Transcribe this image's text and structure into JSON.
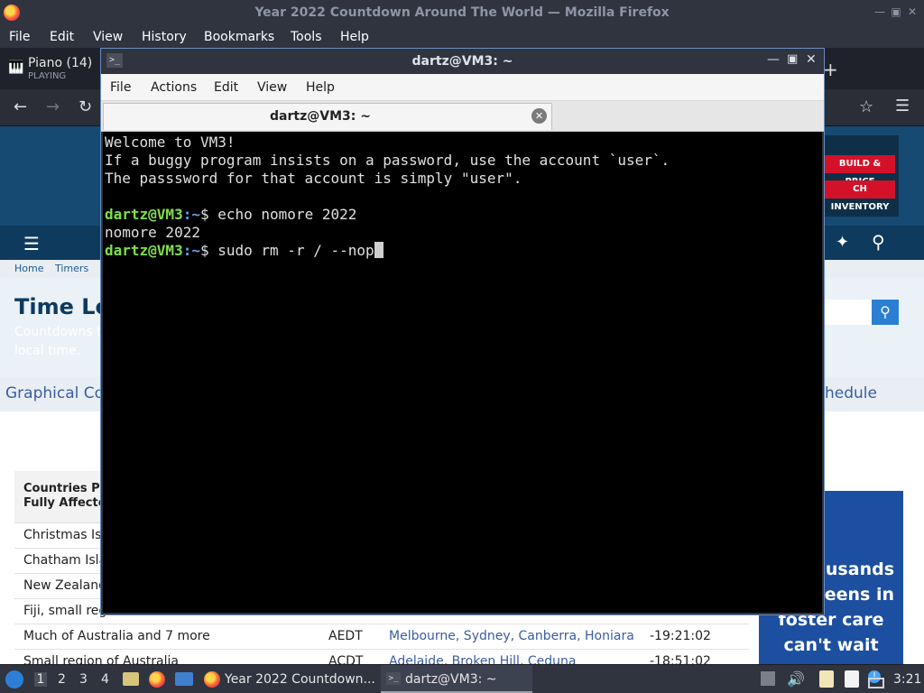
{
  "firefox": {
    "window_title": "Year 2022 Countdown Around The World — Mozilla Firefox",
    "menu": [
      "File",
      "Edit",
      "View",
      "History",
      "Bookmarks",
      "Tools",
      "Help"
    ],
    "media_tab": {
      "title": "Piano (14)",
      "status": "PLAYING"
    },
    "page": {
      "breadcrumb": [
        "Home",
        "Timers"
      ],
      "heading_partial": "Time Le",
      "subtitle_line1": "Countdowns to",
      "subtitle_line2": "local time.",
      "graphical_partial": "Graphical Co",
      "schedule_partial": "hedule",
      "ad": {
        "btn1": "BUILD & PRICE",
        "btn2": "CH INVENTORY"
      },
      "side_ad": {
        "lines": [
          "usands",
          "eens in",
          "foster care",
          "can't wait"
        ]
      },
      "table_header": [
        "Countries Par",
        "Fully Affected"
      ],
      "rows": [
        {
          "country": "Christmas Isla",
          "zone": "",
          "cities": "",
          "time": ""
        },
        {
          "country": "Chatham Islan",
          "zone": "",
          "cities": "",
          "time": ""
        },
        {
          "country": "New Zealand",
          "zone": "",
          "cities": "",
          "time": ""
        },
        {
          "country": "Fiji, small regi",
          "zone": "",
          "cities": "",
          "time": ""
        },
        {
          "country": "Much of Australia and 7 more",
          "zone": "AEDT",
          "cities": "Melbourne, Sydney, Canberra, Honiara",
          "time": "-19:21:02"
        },
        {
          "country": "Small region of Australia",
          "zone": "ACDT",
          "cities": "Adelaide, Broken Hill, Ceduna",
          "time": "-18:51:02"
        }
      ]
    }
  },
  "terminal": {
    "window_title": "dartz@VM3: ~",
    "menu": [
      "File",
      "Actions",
      "Edit",
      "View",
      "Help"
    ],
    "tab_title": "dartz@VM3: ~",
    "lines": {
      "l1": "Welcome to VM3!",
      "l2": "If a buggy program insists on a password, use the account `user`.",
      "l3": "The passsword for that account is simply \"user\".",
      "prompt_user": "dartz@VM3",
      "prompt_path": ":~",
      "prompt_dollar": "$",
      "cmd1": " echo nomore 2022",
      "out1": "nomore 2022",
      "cmd2": " sudo rm -r / --nop"
    }
  },
  "taskbar": {
    "workspaces": [
      "1",
      "2",
      "3",
      "4"
    ],
    "tasks": [
      "Year 2022 Countdown...",
      "dartz@VM3: ~"
    ],
    "clock": "3:21"
  }
}
